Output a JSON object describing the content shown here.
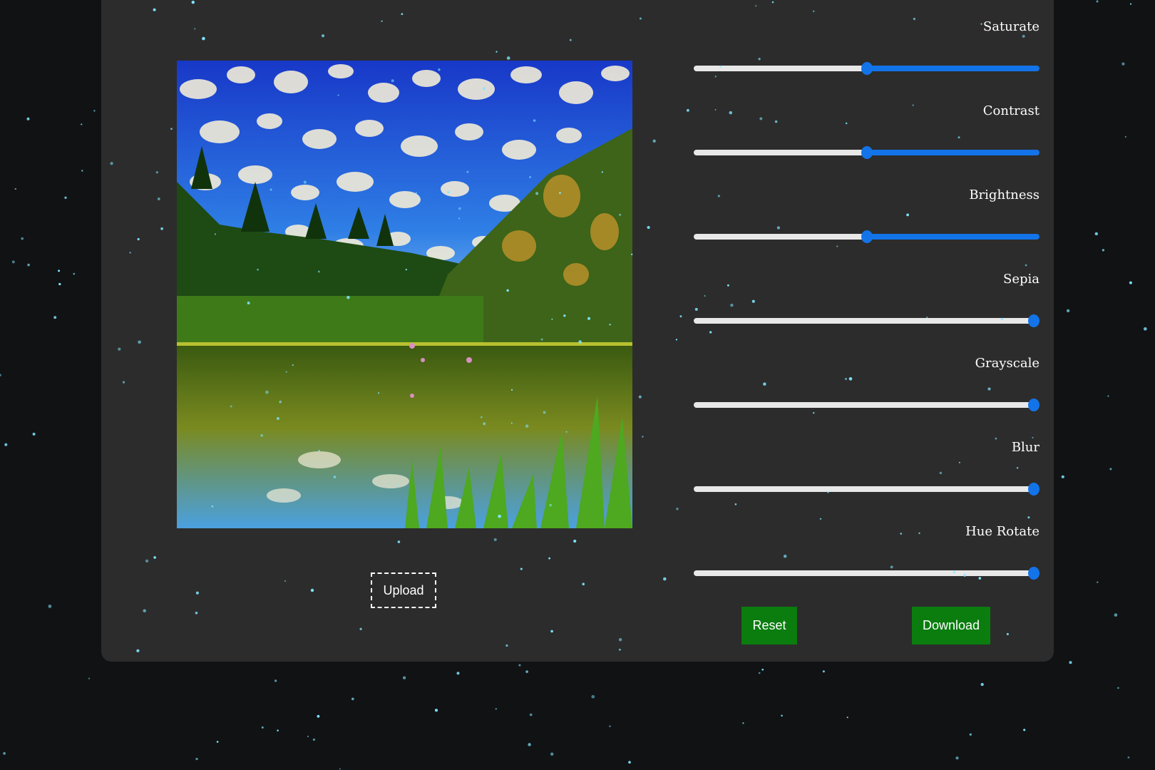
{
  "sliders": [
    {
      "label": "Saturate",
      "value": 0.5
    },
    {
      "label": "Contrast",
      "value": 0.5
    },
    {
      "label": "Brightness",
      "value": 0.5
    },
    {
      "label": "Sepia",
      "value": 1.0
    },
    {
      "label": "Grayscale",
      "value": 1.0
    },
    {
      "label": "Blur",
      "value": 1.0
    },
    {
      "label": "Hue Rotate",
      "value": 1.0
    }
  ],
  "upload_label": "Upload",
  "reset_label": "Reset",
  "download_label": "Download",
  "colors": {
    "background": "#111214",
    "panel": "#2c2c2c",
    "accent": "#1373e8",
    "button": "#0a7d0e",
    "star": "#7fe6ff"
  },
  "preview_image": "landscape-lake-forest-mountain"
}
